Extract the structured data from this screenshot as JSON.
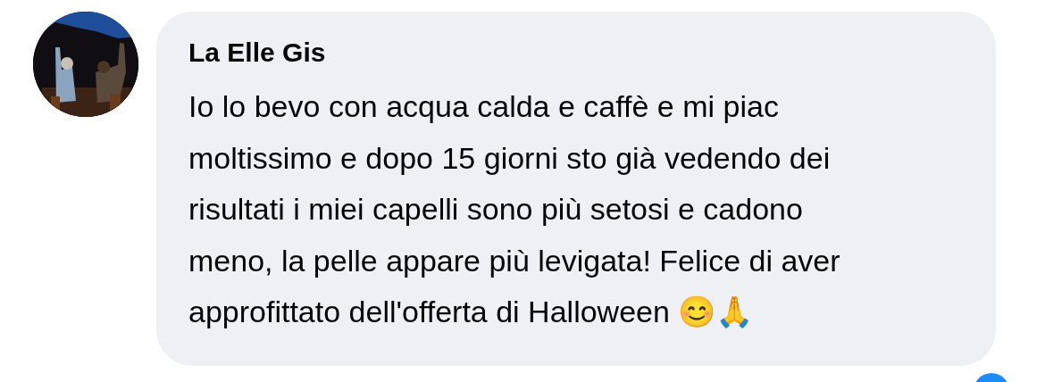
{
  "comment": {
    "author": "La Elle Gis",
    "text": "Io lo bevo con acqua calda e caffè e mi piac\nmoltissimo e dopo 15 giorni sto già vedendo dei\nrisultati i miei capelli sono più setosi e cadono\nmeno, la pelle appare più levigata! Felice di aver\napprofittato dell'offerta di Halloween 😊🙏"
  }
}
